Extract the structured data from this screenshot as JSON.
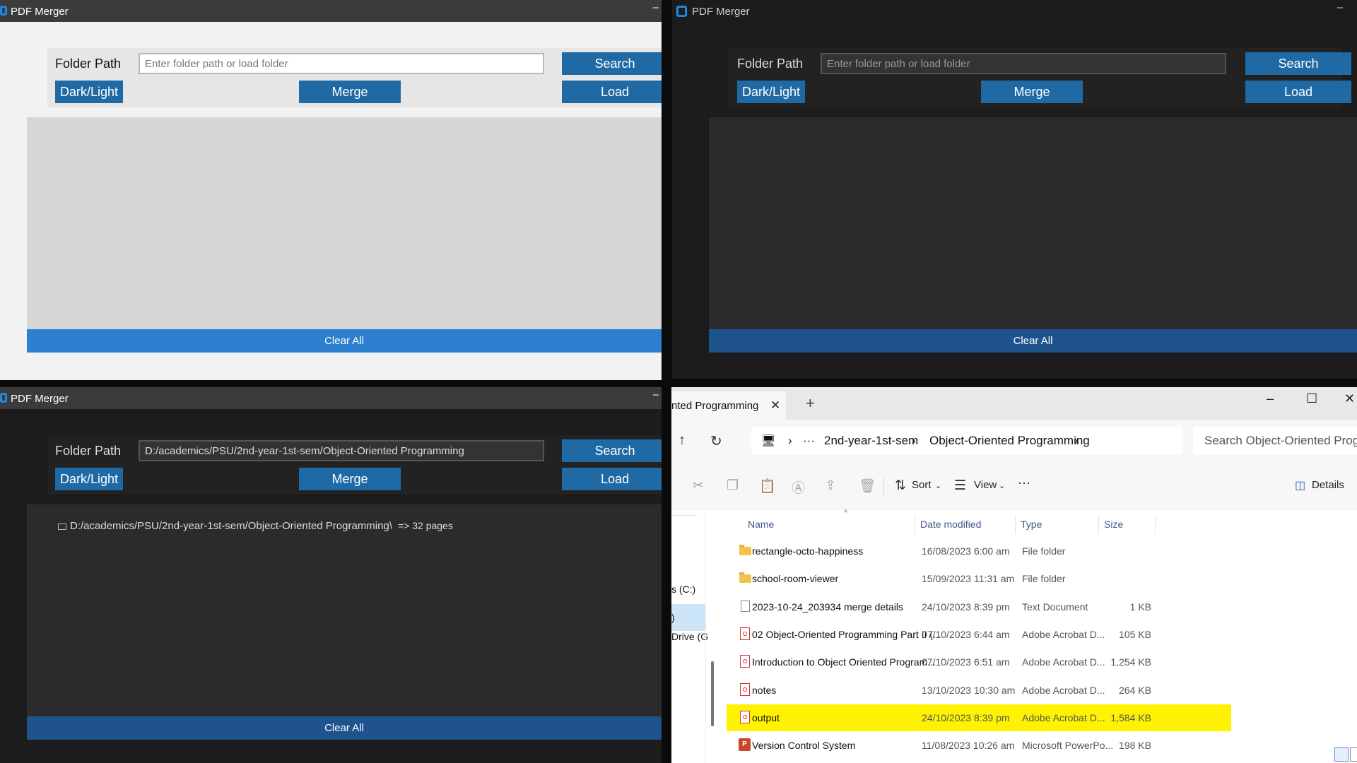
{
  "app": {
    "title": "PDF Merger",
    "folder_label": "Folder Path",
    "placeholder": "Enter folder path or load folder",
    "search_label": "Search",
    "load_label": "Load",
    "darklight_label": "Dark/Light",
    "merge_label": "Merge",
    "clear_label": "Clear All",
    "minimize_glyph": "–"
  },
  "loaded_window": {
    "path_value": "D:/academics/PSU/2nd-year-1st-sem/Object-Oriented Programming",
    "tree_item": "D:/academics/PSU/2nd-year-1st-sem/Object-Oriented Programming\\",
    "pages": "=> 32 pages"
  },
  "explorer": {
    "tab_label": "nted Programming",
    "tab_close": "✕",
    "new_tab": "+",
    "controls": {
      "minimize": "–",
      "maximize": "☐",
      "close": "✕"
    },
    "breadcrumb": [
      "2nd-year-1st-sem",
      "Object-Oriented Programming"
    ],
    "search_placeholder": "Search Object-Oriented Progra",
    "sort_label": "Sort",
    "view_label": "View",
    "more_label": "···",
    "details_label": "Details",
    "sidebar": [
      "s (C:)",
      ")",
      "Drive (G"
    ],
    "columns": {
      "name": "Name",
      "date": "Date modified",
      "type": "Type",
      "size": "Size"
    },
    "files": [
      {
        "name": "rectangle-octo-happiness",
        "date": "16/08/2023 6:00 am",
        "type": "File folder",
        "size": "",
        "icon": "folder-icon"
      },
      {
        "name": "school-room-viewer",
        "date": "15/09/2023 11:31 am",
        "type": "File folder",
        "size": "",
        "icon": "folder-icon"
      },
      {
        "name": "2023-10-24_203934 merge details",
        "date": "24/10/2023 8:39 pm",
        "type": "Text Document",
        "size": "1 KB",
        "icon": "text-file-icon"
      },
      {
        "name": "02 Object-Oriented Programming Part II (...",
        "date": "07/10/2023 6:44 am",
        "type": "Adobe Acrobat D...",
        "size": "105 KB",
        "icon": "pdf-icon"
      },
      {
        "name": "Introduction to Object Oriented Program...",
        "date": "07/10/2023 6:51 am",
        "type": "Adobe Acrobat D...",
        "size": "1,254 KB",
        "icon": "pdf-icon"
      },
      {
        "name": "notes",
        "date": "13/10/2023 10:30 am",
        "type": "Adobe Acrobat D...",
        "size": "264 KB",
        "icon": "pdf-icon"
      },
      {
        "name": "output",
        "date": "24/10/2023 8:39 pm",
        "type": "Adobe Acrobat D...",
        "size": "1,584 KB",
        "icon": "pdf-icon",
        "highlighted": true
      },
      {
        "name": "Version Control System",
        "date": "11/08/2023 10:26 am",
        "type": "Microsoft PowerPo...",
        "size": "198 KB",
        "icon": "ppt-icon"
      }
    ]
  },
  "colors": {
    "accent": "#1f6aa5",
    "highlight": "#fff200"
  }
}
